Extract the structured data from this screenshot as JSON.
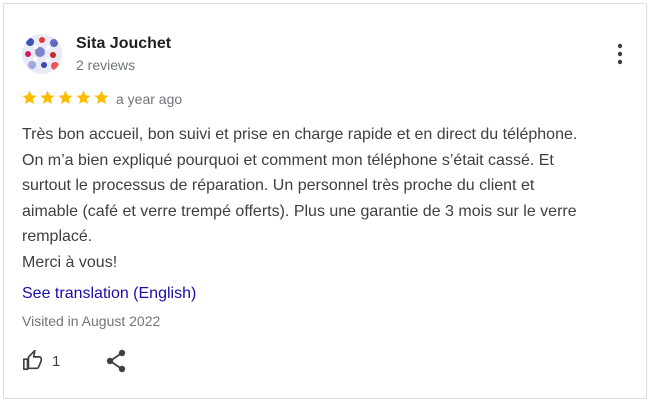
{
  "review": {
    "author_name": "Sita Jouchet",
    "review_count": "2 reviews",
    "rating": 5,
    "rating_max": 5,
    "time_ago": "a year ago",
    "text_lines": [
      "Très bon accueil, bon suivi et prise en charge rapide et en direct du téléphone.",
      "On m’a bien expliqué pourquoi et comment mon téléphone s’était cassé. Et",
      "surtout le processus de réparation. Un personnel très proche du client et",
      "aimable (café et verre trempé offerts). Plus une garantie de 3 mois sur le verre",
      "remplacé.",
      "Merci à vous!"
    ],
    "translate_link": "See translation (English)",
    "visited": "Visited in August 2022",
    "like_count": "1"
  },
  "icons": {
    "avatar": "avatar-pattern",
    "more": "more-vert-icon",
    "star": "star-icon",
    "like": "thumbs-up-icon",
    "share": "share-icon"
  },
  "colors": {
    "star": "#fbbc04",
    "link": "#1a0dab",
    "muted": "#70757a",
    "text": "#3c4043"
  }
}
